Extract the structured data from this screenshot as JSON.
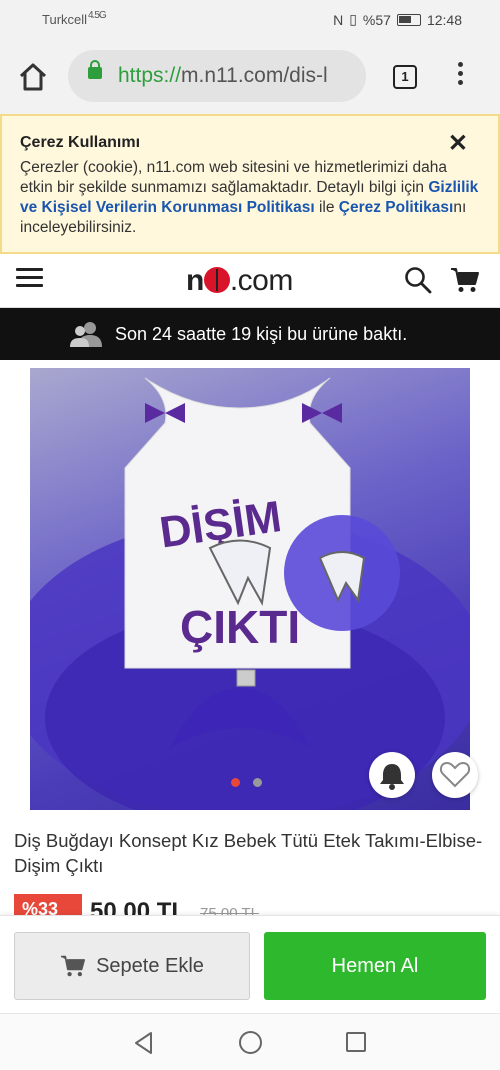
{
  "status_bar": {
    "carrier": "Turkcell",
    "signal": "4.5G",
    "battery_percent": "%57",
    "time": "12:48"
  },
  "browser": {
    "url_scheme": "https://",
    "url_rest": "m.n11.com/dis-l",
    "tab_count": "1"
  },
  "cookie_banner": {
    "title": "Çerez Kullanımı",
    "text_1": "Çerezler (cookie), n11.com web sitesini ve hizmetlerimizi daha etkin bir şekilde sunmamızı sağlamaktadır. Detaylı bilgi için ",
    "link_privacy": "Gizlilik ve Kişisel Verilerin Korunması Politikası",
    "text_2": " ile ",
    "link_cookie": "Çerez Politikası",
    "text_3": "nı inceleyebilirsiniz.",
    "close": "✕"
  },
  "header": {
    "logo_prefix": "n",
    "logo_num": "11",
    "logo_suffix": ".com"
  },
  "viewed_bar": {
    "text": "Son 24 saatte 19 kişi bu ürüne baktı."
  },
  "product": {
    "shirt_text_1": "DİŞİM",
    "shirt_text_2": "ÇIKTI",
    "title": "Diş Buğdayı Konsept Kız Bebek Tütü Etek Takımı-Elbise-Dişim Çıktı",
    "discount": "%33",
    "price": "50,00 TL",
    "old_price": "75,00 TL",
    "image_count": 2,
    "active_image": 1
  },
  "actions": {
    "add_to_cart": "Sepete Ekle",
    "buy_now": "Hemen Al"
  },
  "colors": {
    "accent_green": "#2eb82e",
    "discount_red": "#e8483a",
    "link_blue": "#1a56b0",
    "url_green": "#2e9e3c"
  },
  "icons": [
    "home-icon",
    "lock-icon",
    "tabs-icon",
    "overflow-menu-icon",
    "close-icon",
    "hamburger-icon",
    "search-icon",
    "cart-icon",
    "users-icon",
    "bell-icon",
    "heart-icon",
    "back-icon",
    "home-circle-icon",
    "recents-icon"
  ]
}
